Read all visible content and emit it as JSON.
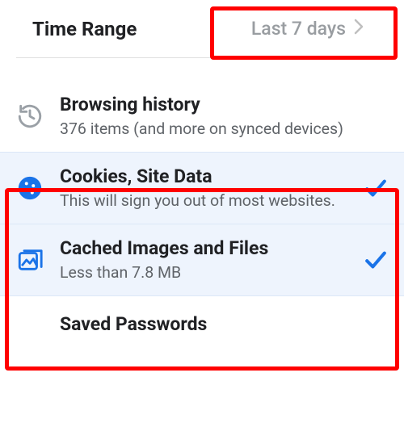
{
  "timeRange": {
    "label": "Time Range",
    "value": "Last 7 days"
  },
  "items": [
    {
      "title": "Browsing history",
      "subtitle": "376 items (and more on synced devices)",
      "selected": false
    },
    {
      "title": "Cookies, Site Data",
      "subtitle": "This will sign you out of most websites.",
      "selected": true
    },
    {
      "title": "Cached Images and Files",
      "subtitle": "Less than 7.8 MB",
      "selected": true
    },
    {
      "title": "Saved Passwords",
      "subtitle": "",
      "selected": false
    }
  ]
}
